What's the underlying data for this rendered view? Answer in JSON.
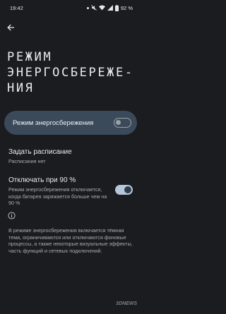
{
  "status_bar": {
    "time": "19:42",
    "battery_percent": "92 %",
    "icons": [
      "dot-icon",
      "mute-icon",
      "wifi-icon",
      "signal-icon",
      "battery-icon"
    ]
  },
  "header": {
    "back_icon": "arrow-left-icon",
    "title": "РЕЖИМ ЭНЕРГОСБЕРЕЖЕ-НИЯ"
  },
  "main_toggle": {
    "label": "Режим энергосбережения",
    "state": "off"
  },
  "schedule": {
    "title": "Задать расписание",
    "subtitle": "Расписания нет"
  },
  "threshold": {
    "title": "Отключать при 90 %",
    "description": "Режим энергосбережения отключается, когда батарея заряжается больше чем на 90 %",
    "state": "on"
  },
  "info": {
    "icon": "info-icon",
    "text": "В режиме энергосбережения включается тёмная тема, ограничиваются или отключаются фоновые процессы, а также некоторые визуальные эффекты, часть функций и сетевых подключений."
  },
  "watermark": "3DNEWS",
  "colors": {
    "background": "#1b1c1f",
    "card": "#3b4a5a",
    "switch_on_track": "#b5c7da",
    "switch_on_knob": "#2e3d4c"
  }
}
